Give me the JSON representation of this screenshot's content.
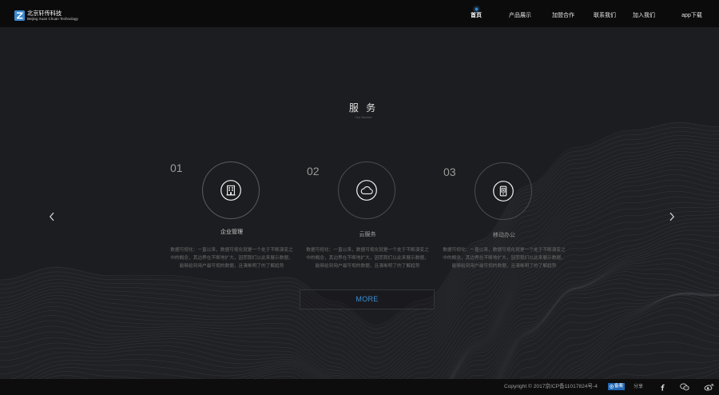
{
  "header": {
    "logo": {
      "name": "北京轩传科技",
      "subtitle": "Beijing Xuan Chuan Technology",
      "icon": "company-logo-icon"
    },
    "nav": [
      {
        "label": "首页",
        "active": true
      },
      {
        "label": "产品展示",
        "active": false
      },
      {
        "label": "加盟合作",
        "active": false
      },
      {
        "label": "联系我们",
        "active": false
      },
      {
        "label": "加入我们",
        "active": false
      },
      {
        "label": "app下载",
        "active": false
      }
    ]
  },
  "services": {
    "title": "服 务",
    "subtitle": "Our Service",
    "items": [
      {
        "number": "01",
        "label": "企业管理",
        "icon": "building-icon",
        "description": [
          "数据可视化：一直以来，数据可视化就是一个处于不断演变之",
          "中的概念，其边界在不断地扩大，因而我们以此来展示数据，",
          "能够给到用户最可视的数据，且清晰明了的了解趋势"
        ]
      },
      {
        "number": "02",
        "label": "云服务",
        "icon": "cloud-icon",
        "description": [
          "数据可视化：一直以来，数据可视化就是一个处于不断演变之",
          "中的概念，其边界在不断地扩大，因而我们以此来展示数据，",
          "能够给到用户最可视的数据，且清晰明了的了解趋势"
        ]
      },
      {
        "number": "03",
        "label": "移动办公",
        "icon": "mobile-office-icon",
        "description": [
          "数据可视化：一直以来，数据可视化就是一个处于不断演变之",
          "中的概念，其边界在不断地扩大，因而我们以此来展示数据，",
          "能够给到用户最可视的数据，且清晰明了的了解趋势"
        ]
      }
    ],
    "more_label": "MORE"
  },
  "carousel": {
    "prev_icon": "chevron-left-icon",
    "next_icon": "chevron-right-icon"
  },
  "footer": {
    "copyright": "Copyright © 2017京ICP备11017824号-4",
    "badge": "备案",
    "share_label": "分享",
    "share_icons": [
      "facebook-icon",
      "wechat-icon",
      "weibo-icon"
    ]
  },
  "colors": {
    "accent": "#3a8fd6",
    "header_bg": "#0b0b0c",
    "page_bg": "#1c1d20",
    "badge_bg": "#2268b5"
  }
}
